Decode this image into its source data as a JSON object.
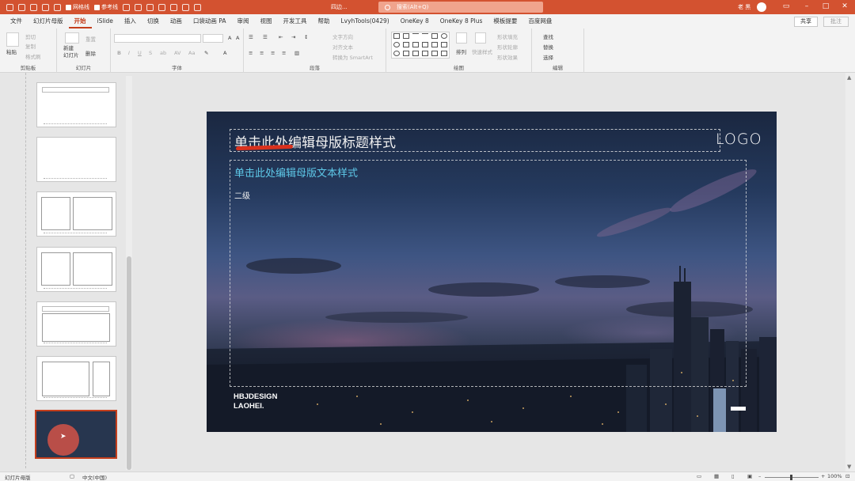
{
  "titlebar": {
    "autosave_check": "网格线",
    "guide_check": "参考线",
    "document": "四边...",
    "search_placeholder": "搜索(Alt+Q)",
    "user": "老 黑"
  },
  "tabs": [
    "文件",
    "幻灯片母版",
    "开始",
    "iSlide",
    "插入",
    "切换",
    "动画",
    "口袋动画 PA",
    "审阅",
    "视图",
    "开发工具",
    "帮助",
    "LvyhTools(0429)",
    "OneKey 8",
    "OneKey 8 Plus",
    "模板提要",
    "百度网盘"
  ],
  "active_tab": "开始",
  "share_label": "共享",
  "comment_label": "批注",
  "ribbon": {
    "clipboard": {
      "paste": "粘贴",
      "cut": "剪切",
      "copy": "复制",
      "painter": "格式刷",
      "label": "剪贴板"
    },
    "slides": {
      "new_slide": "新建\n幻灯片",
      "reset": "重置",
      "delete": "删除",
      "label": "幻灯片"
    },
    "font": {
      "label": "字体"
    },
    "paragraph": {
      "text_direction": "文字方向",
      "align_text": "对齐文本",
      "smartart": "转换为 SmartArt",
      "label": "段落"
    },
    "drawing": {
      "arrange": "排列",
      "quick_styles": "快速样式",
      "fill": "形状填充",
      "outline": "形状轮廓",
      "effects": "形状效果",
      "label": "绘图"
    },
    "editing": {
      "find": "查找",
      "replace": "替换",
      "select": "选择",
      "label": "编辑"
    }
  },
  "slide": {
    "title_placeholder": "单击此处编辑母版标题样式",
    "logo": "LOGO",
    "body_level1": "单击此处编辑母版文本样式",
    "body_level2": "二级",
    "brand_line1": "HBJDESIGN",
    "brand_line2": "LAOHEI."
  },
  "status": {
    "view": "幻灯片母版",
    "language": "中文(中国)",
    "zoom": "100%"
  },
  "colors": {
    "accent": "#d35230",
    "body_title": "#5ec8e8"
  }
}
